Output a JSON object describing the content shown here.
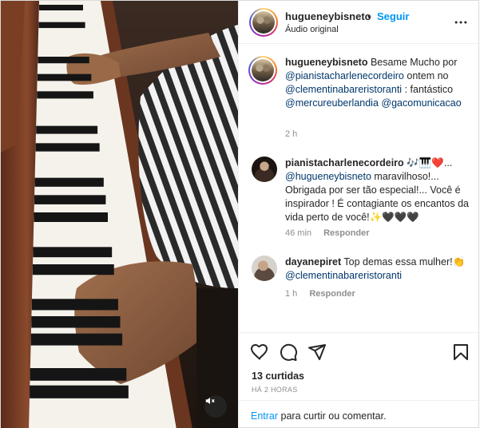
{
  "header": {
    "username": "hugueneybisneto",
    "dot": "•",
    "follow_label": "Seguir",
    "audio_label": "Áudio original"
  },
  "caption": {
    "username": "hugueneybisneto",
    "text_1": "Besame Mucho por",
    "mention_1": "@pianistacharlenecordeiro",
    "text_2": "ontem no",
    "mention_2": "@clementinabareristoranti",
    "text_3": ": fantástico",
    "mention_3": "@mercureuberlandia",
    "mention_4": "@gacomunicacao",
    "time": "2 h"
  },
  "comments": [
    {
      "username": "pianistacharlenecordeiro",
      "emoji_after_name": "🎶🎹❤️...",
      "mention": "@hugueneybisneto",
      "text": "maravilhoso!... Obrigada por ser tão especial!... Você é inspirador ! É contagiante os encantos da vida perto de você!✨🖤🖤🖤",
      "time": "46 min",
      "reply_label": "Responder"
    },
    {
      "username": "dayanepiret",
      "text": "Top demas essa mulher!👏",
      "mention": "@clementinabareristoranti",
      "time": "1 h",
      "reply_label": "Responder"
    }
  ],
  "actions": {
    "like_icon": "heart-icon",
    "comment_icon": "comment-icon",
    "share_icon": "share-icon",
    "save_icon": "bookmark-icon"
  },
  "likes": "13 curtidas",
  "time_ago": "HÁ 2 HORAS",
  "comment_bar": {
    "login_link": "Entrar",
    "login_text": "para curtir ou comentar."
  },
  "colors": {
    "link": "#00376b",
    "follow": "#0095f6",
    "meta": "#8e8e8e"
  }
}
